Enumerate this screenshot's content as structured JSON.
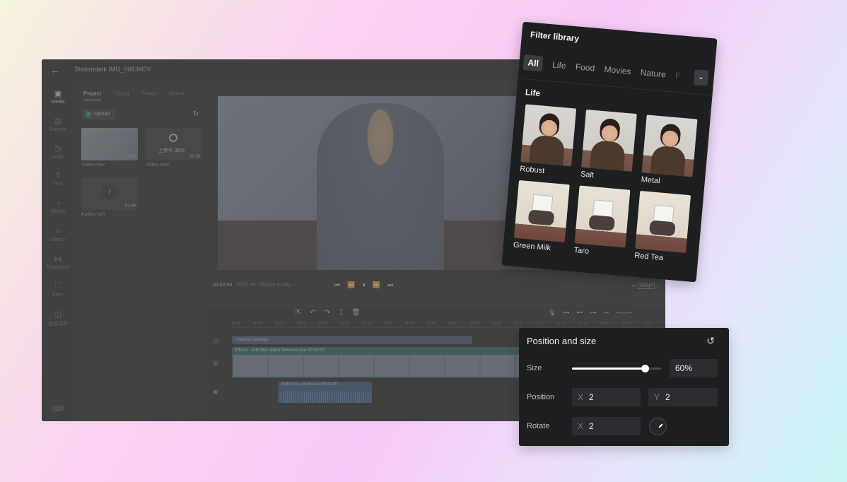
{
  "editor": {
    "title": "Shotondark IMG_008.MOV",
    "nav": [
      {
        "label": "Media",
        "icon": "media-icon",
        "glyph": "▣"
      },
      {
        "label": "Material",
        "icon": "material-icon",
        "glyph": "▤"
      },
      {
        "label": "Audio",
        "icon": "audio-icon",
        "glyph": "◷"
      },
      {
        "label": "Text",
        "icon": "text-icon",
        "glyph": "T"
      },
      {
        "label": "Sticker",
        "icon": "sticker-icon",
        "glyph": "◔"
      },
      {
        "label": "Effects",
        "icon": "effects-icon",
        "glyph": "✧"
      },
      {
        "label": "Transitions",
        "icon": "transitions-icon",
        "glyph": "⋈"
      },
      {
        "label": "Filter",
        "icon": "filter-icon",
        "glyph": "⛶"
      },
      {
        "label": "画面调节",
        "icon": "adjust-icon",
        "glyph": "◫"
      }
    ],
    "tabs": [
      "Project",
      "Cloud",
      "Team",
      "Share"
    ],
    "upload_label": "Upload",
    "media": [
      {
        "name": "Video.mov",
        "meta": "0:12"
      },
      {
        "name": "Video.mov",
        "meta": "01:30",
        "status": "上传中 38%"
      },
      {
        "name": "Audio.mp3",
        "meta": "01:39"
      }
    ],
    "playback": {
      "current": "00:02:45",
      "total": "00:27:59",
      "quality": "Picture quality ˅",
      "adapt": "Adapt"
    },
    "timeline": {
      "ruler": [
        "00:00",
        "00:05",
        "00:10",
        "00:15",
        "00:20",
        "00:25",
        "00:30",
        "00:35",
        "00:40",
        "00:45",
        "00:50",
        "00:55",
        "01:00",
        "01:05",
        "01:10",
        "01:15",
        "01:20",
        "01:25",
        "01:30",
        "01:35"
      ],
      "package_label": "material package",
      "video_label": "Effects - Edit   filter   adjust   filename.mov   00:00:00",
      "audio_label": "Shift 0.0x  sound.wav  00:00:00"
    }
  },
  "filter_library": {
    "title": "Filter library",
    "tabs": [
      "All",
      "Life",
      "Food",
      "Movies",
      "Nature",
      "F"
    ],
    "section": "Life",
    "filters": [
      {
        "name": "Robust",
        "kind": "portrait"
      },
      {
        "name": "Salt",
        "kind": "portrait"
      },
      {
        "name": "Metal",
        "kind": "portrait"
      },
      {
        "name": "Green Milk",
        "kind": "paper"
      },
      {
        "name": "Taro",
        "kind": "paper"
      },
      {
        "name": "Red Tea",
        "kind": "paper"
      }
    ]
  },
  "position_panel": {
    "title": "Position and size",
    "size_label": "Size",
    "size_value": "60%",
    "size_fraction": 0.82,
    "position_label": "Position",
    "pos_x_axis": "X",
    "pos_x": "2",
    "pos_y_axis": "Y",
    "pos_y": "2",
    "rotate_label": "Rotate",
    "rot_x_axis": "X",
    "rot_x": "2"
  }
}
